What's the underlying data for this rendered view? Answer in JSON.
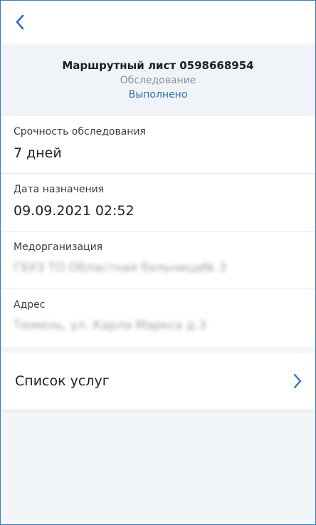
{
  "header": {
    "title": "Маршрутный лист 0598668954",
    "subtitle": "Обследование",
    "status": "Выполнено"
  },
  "fields": [
    {
      "label": "Срочность обследования",
      "value": "7 дней",
      "blurred": false
    },
    {
      "label": "Дата назначения",
      "value": "09.09.2021 02:52",
      "blurred": false
    },
    {
      "label": "Медорганизация",
      "value": "ГБУЗ ТО Областная больница№ 3",
      "blurred": true
    },
    {
      "label": "Адрес",
      "value": "Тюмень, ул. Карла Маркса д.3",
      "blurred": true
    }
  ],
  "services": {
    "label": "Список услуг"
  },
  "colors": {
    "accent": "#2f6fb3",
    "header_bg": "#f0f4f8",
    "page_bg": "#f3f6f9",
    "border": "#3a79c2"
  },
  "icons": {
    "back": "chevron-left-icon",
    "services": "chevron-right-icon"
  }
}
